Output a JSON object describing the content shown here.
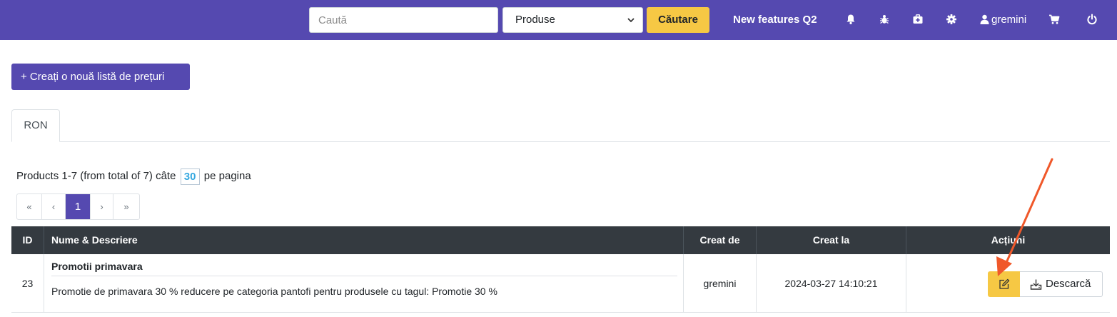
{
  "navbar": {
    "search_placeholder": "Caută",
    "select_value": "Produse",
    "search_button": "Căutare",
    "new_features": "New features Q2",
    "username": "gremini",
    "icons": [
      "bell-icon",
      "bug-icon",
      "medkit-icon",
      "gear-icon",
      "user-icon",
      "cart-icon",
      "power-icon"
    ]
  },
  "create_button": "+ Creați o nouă listă de prețuri",
  "tabs": [
    "RON"
  ],
  "pager": {
    "info_prefix": "Products 1-7 (from total of 7) câte",
    "per_page": "30",
    "info_suffix": "pe pagina",
    "pages": [
      "«",
      "‹",
      "1",
      "›",
      "»"
    ],
    "active_page": "1"
  },
  "table": {
    "headers": [
      "ID",
      "Nume & Descriere",
      "Creat de",
      "Creat la",
      "Acțiuni"
    ],
    "rows": [
      {
        "id": "23",
        "name": "Promotii primavara",
        "description": "Promotie de primavara 30 % reducere pe categoria pantofi pentru produsele cu tagul: Promotie 30 %",
        "created_by": "gremini",
        "created_at": "2024-03-27 14:10:21",
        "download_label": "Descarcă"
      }
    ]
  },
  "colors": {
    "brand": "#5549b0",
    "accent": "#f6c844",
    "table_header": "#343a40",
    "annotation_arrow": "#f0582a"
  }
}
